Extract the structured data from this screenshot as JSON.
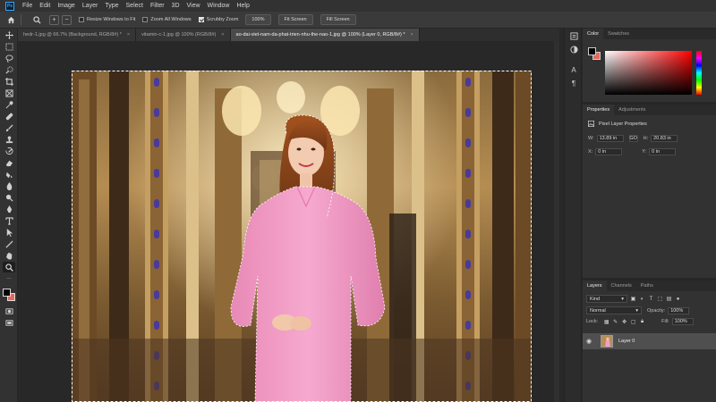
{
  "app": {
    "logo": "Ps"
  },
  "menu": [
    "File",
    "Edit",
    "Image",
    "Layer",
    "Type",
    "Select",
    "Filter",
    "3D",
    "View",
    "Window",
    "Help"
  ],
  "options": {
    "resize_windows": "Resize Windows to Fit",
    "zoom_all": "Zoom All Windows",
    "scrubby_zoom": "Scrubby Zoom",
    "zoom_value": "100%",
    "fit_screen": "Fit Screen",
    "fill_screen": "Fill Screen",
    "resize_checked": false,
    "zoom_all_checked": false,
    "scrubby_checked": true
  },
  "tabs": [
    {
      "label": "hedr-1.jpg @ 66.7% (Background, RGB/8#) *",
      "close": "×"
    },
    {
      "label": "vitamin-c-1.jpg @ 100% (RGB/8#)",
      "close": "×"
    },
    {
      "label": "ao-dai-viet-nam-da-phat-trien-nhu-the-nao-1.jpg @ 100% (Layer 0, RGB/8#) *",
      "close": "×"
    }
  ],
  "color_panel": {
    "tabs": [
      "Color",
      "Swatches"
    ],
    "foreground": "#000000",
    "background": "#e5685e"
  },
  "properties": {
    "tabs": [
      "Properties",
      "Adjustments"
    ],
    "section": "Pixel Layer Properties",
    "w_label": "W:",
    "w_value": "13.89 in",
    "h_label": "H:",
    "h_value": "20.83 in",
    "x_label": "X:",
    "x_value": "0 in",
    "y_label": "Y:",
    "y_value": "0 in",
    "link": "GO"
  },
  "layers": {
    "tabs": [
      "Layers",
      "Channels",
      "Paths"
    ],
    "filter": "Kind",
    "blend_mode": "Normal",
    "opacity_label": "Opacity:",
    "opacity_value": "100%",
    "lock_label": "Lock:",
    "fill_label": "Fill:",
    "fill_value": "100%",
    "items": [
      {
        "name": "Layer 0"
      }
    ]
  }
}
